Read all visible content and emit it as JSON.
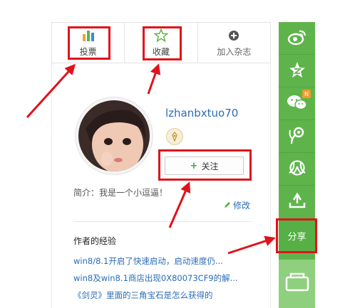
{
  "actions": {
    "vote_label": "投票",
    "collect_label": "收藏",
    "magazine_label": "加入杂志"
  },
  "profile": {
    "username": "lzhanbxtuo70",
    "follow_label": "关注",
    "intro": "简介：我是一个小逗逼！",
    "edit_label": "修改"
  },
  "experience": {
    "title": "作者的经验",
    "items": [
      "win8/8.1开启了快速启动，启动速度仍...",
      "win8及win8.1商店出现0X80073CF9的解...",
      "《剑灵》里面的三角宝石是怎么获得的"
    ]
  },
  "sharebar": {
    "items": [
      "weibo-icon",
      "qzone-icon",
      "wechat-icon",
      "tencent-weibo-icon",
      "renren-icon",
      "share-tool-icon"
    ],
    "new_badge": "N",
    "share_label": "分享"
  },
  "colors": {
    "share_green": "#5eb44b",
    "highlight_red": "#e0121b",
    "link_blue": "#2a6db5"
  }
}
